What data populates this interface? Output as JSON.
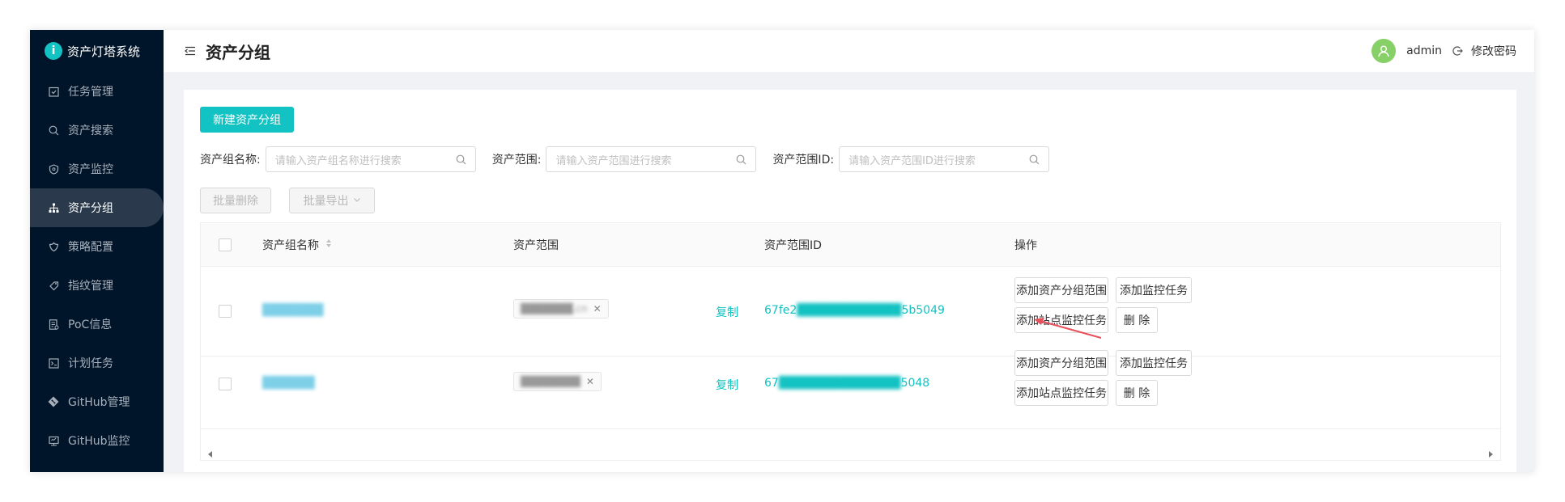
{
  "app": {
    "title": "资产灯塔系统"
  },
  "sidebar": {
    "items": [
      {
        "label": "任务管理",
        "icon": "task-icon"
      },
      {
        "label": "资产搜索",
        "icon": "search-icon"
      },
      {
        "label": "资产监控",
        "icon": "shield-icon"
      },
      {
        "label": "资产分组",
        "icon": "group-icon",
        "active": true
      },
      {
        "label": "策略配置",
        "icon": "policy-icon"
      },
      {
        "label": "指纹管理",
        "icon": "fingerprint-icon"
      },
      {
        "label": "PoC信息",
        "icon": "poc-icon"
      },
      {
        "label": "计划任务",
        "icon": "schedule-icon"
      },
      {
        "label": "GitHub管理",
        "icon": "github-icon"
      },
      {
        "label": "GitHub监控",
        "icon": "monitor-icon"
      }
    ]
  },
  "header": {
    "title": "资产分组",
    "user": "admin",
    "change_password": "修改密码"
  },
  "toolbar": {
    "new_group": "新建资产分组",
    "batch_delete": "批量删除",
    "batch_export": "批量导出"
  },
  "search": {
    "name_label": "资产组名称:",
    "name_placeholder": "请输入资产组名称进行搜索",
    "scope_label": "资产范围:",
    "scope_placeholder": "请输入资产范围进行搜索",
    "scope_id_label": "资产范围ID:",
    "scope_id_placeholder": "请输入资产范围ID进行搜索"
  },
  "table": {
    "columns": [
      "资产组名称",
      "资产范围",
      "资产范围ID",
      "操作"
    ],
    "rows": [
      {
        "name": "███████",
        "scope": "███████.cn",
        "copy": "复制",
        "scope_id_prefix": "67fe2",
        "scope_id_mask": "████████████",
        "scope_id_suffix": "5b5049"
      },
      {
        "name": "██████",
        "scope": "████████",
        "copy": "复制",
        "scope_id_prefix": "67",
        "scope_id_mask": "██████████████",
        "scope_id_suffix": "5048"
      }
    ],
    "actions": {
      "add_scope": "添加资产分组范围",
      "add_monitor": "添加监控任务",
      "add_site_monitor": "添加站点监控任务",
      "delete": "删 除"
    }
  },
  "colors": {
    "accent": "#13c2c2",
    "sidebar_bg": "#001529",
    "annotation": "#e8505b"
  }
}
